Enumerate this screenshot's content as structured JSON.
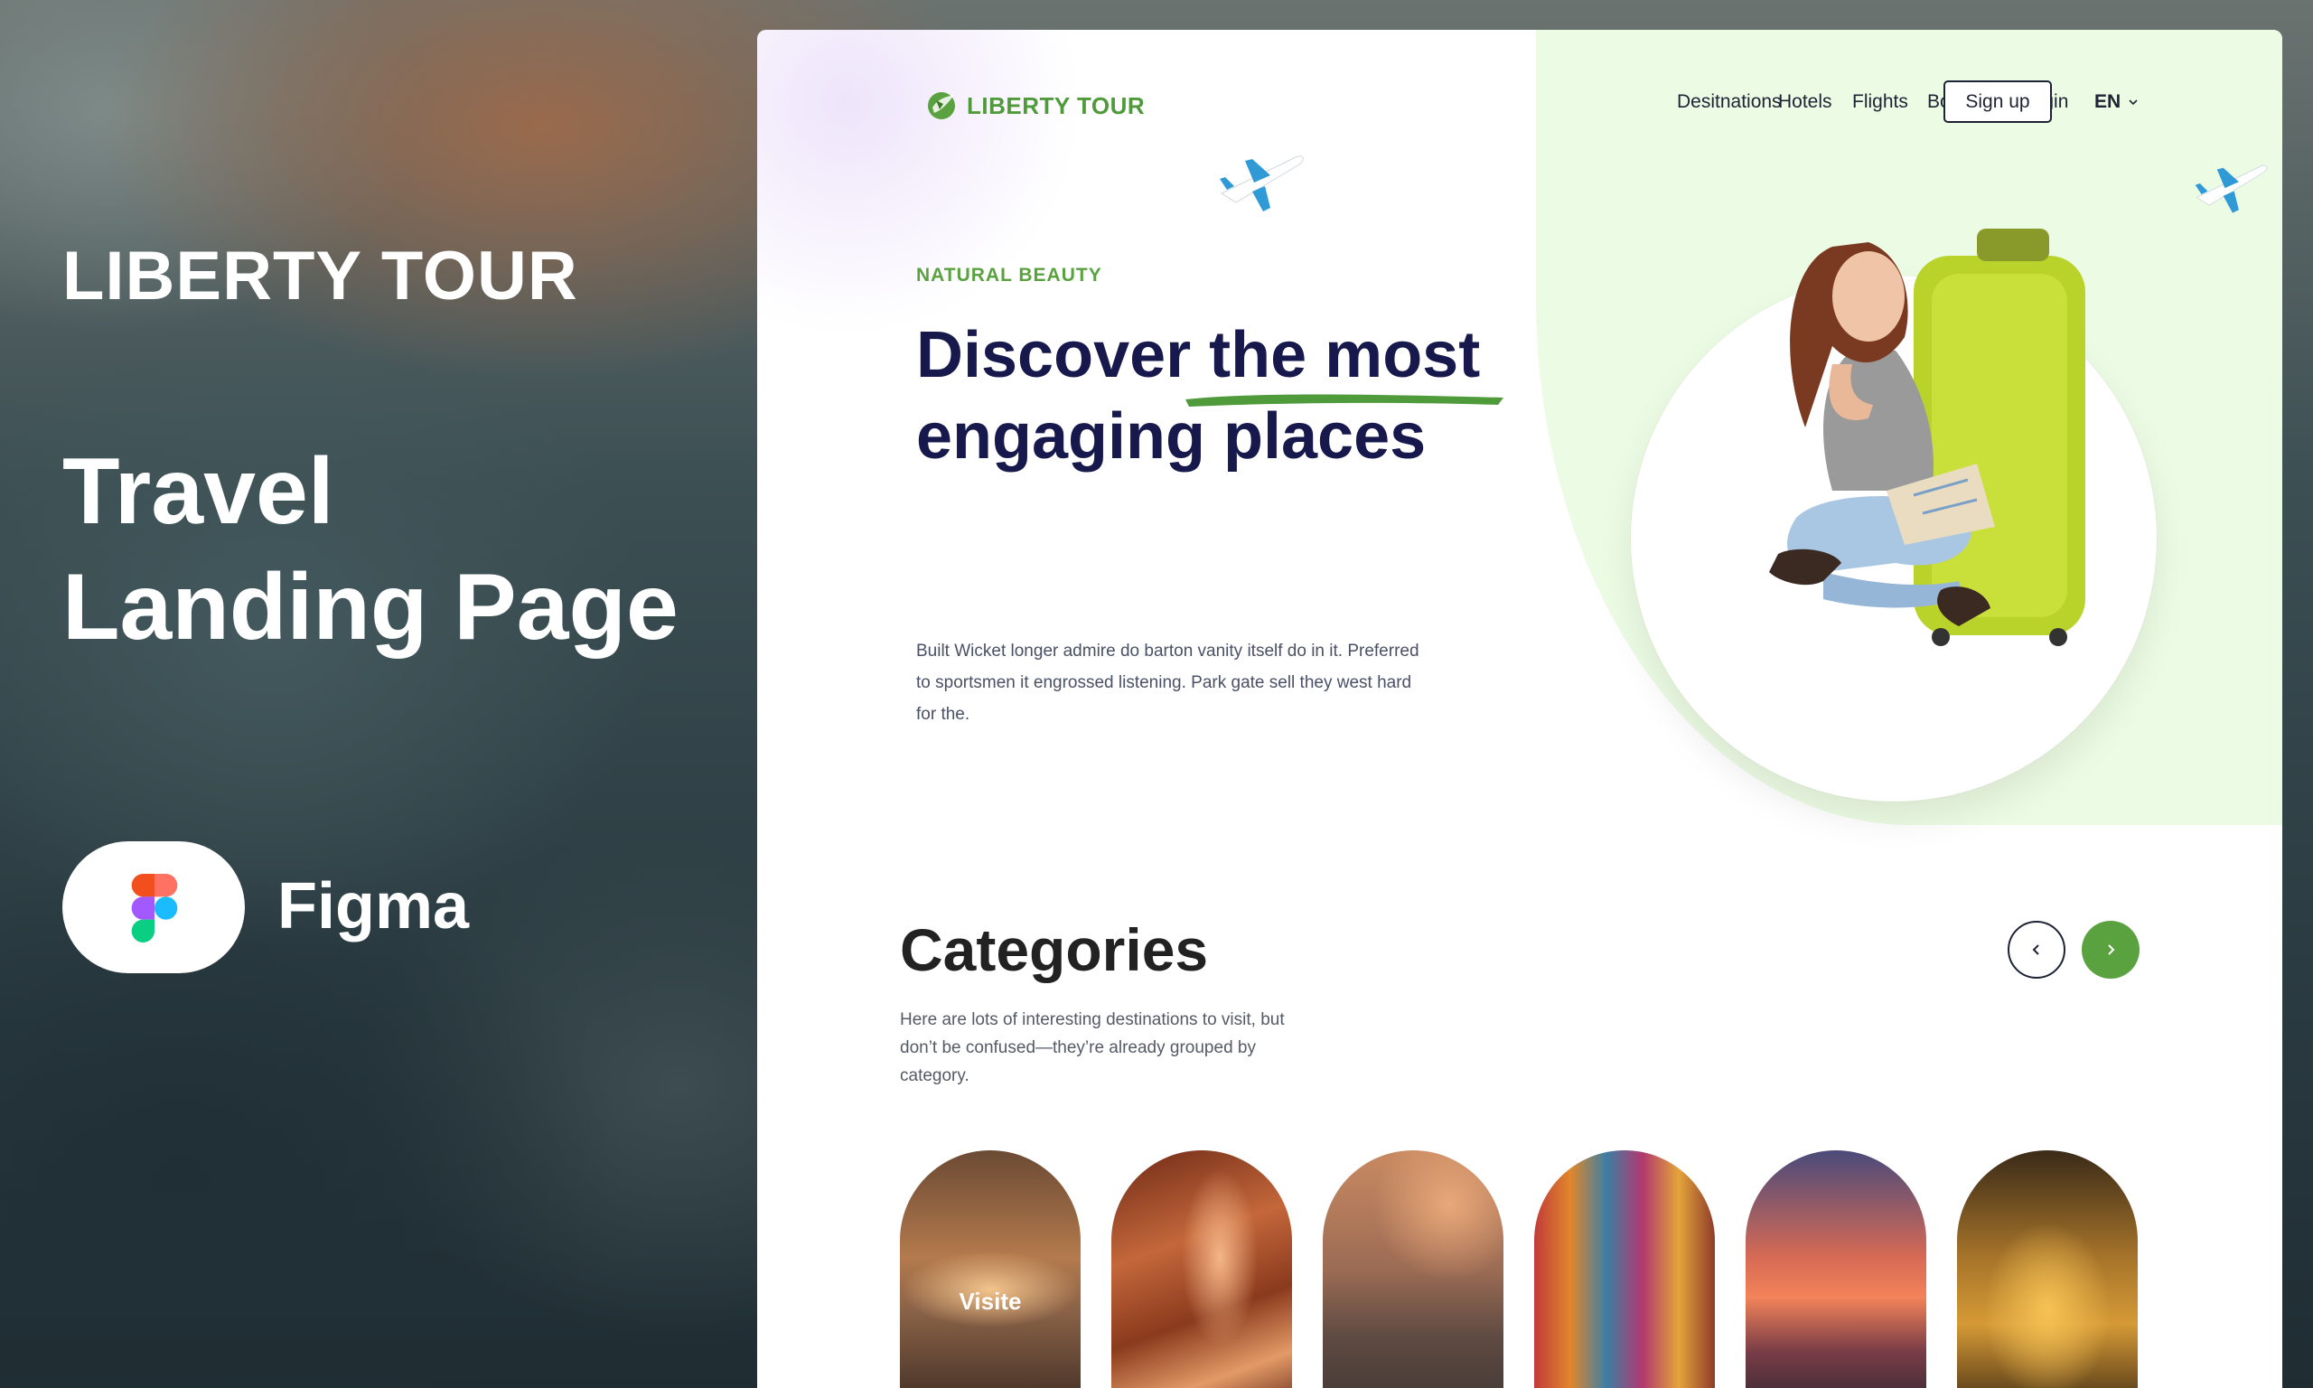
{
  "promo": {
    "brand": "LIBERTY TOUR",
    "title_line1": "Travel",
    "title_line2": "Landing Page",
    "tool_label": "Figma"
  },
  "nav": {
    "logo_text": "LIBERTY TOUR",
    "links": [
      "Desitnations",
      "Hotels",
      "Flights",
      "Bookings",
      "Login"
    ],
    "signup_label": "Sign up",
    "language": "EN"
  },
  "hero": {
    "eyebrow": "NATURAL BEAUTY",
    "title": "Discover the most engaging  places",
    "description": "Built Wicket longer admire do barton vanity itself do in it. Preferred to sportsmen it engrossed listening. Park gate sell they west hard for the."
  },
  "categories": {
    "title": "Categories",
    "description": "Here are lots of interesting destinations to visit, but don’t be confused—they’re already grouped by category.",
    "items": [
      {
        "label": "Visite"
      },
      {
        "label": ""
      },
      {
        "label": ""
      },
      {
        "label": ""
      },
      {
        "label": ""
      },
      {
        "label": ""
      }
    ]
  },
  "colors": {
    "brand_green": "#5aa23f",
    "navy": "#17194d",
    "hero_bg_green": "#ecfbe3"
  }
}
